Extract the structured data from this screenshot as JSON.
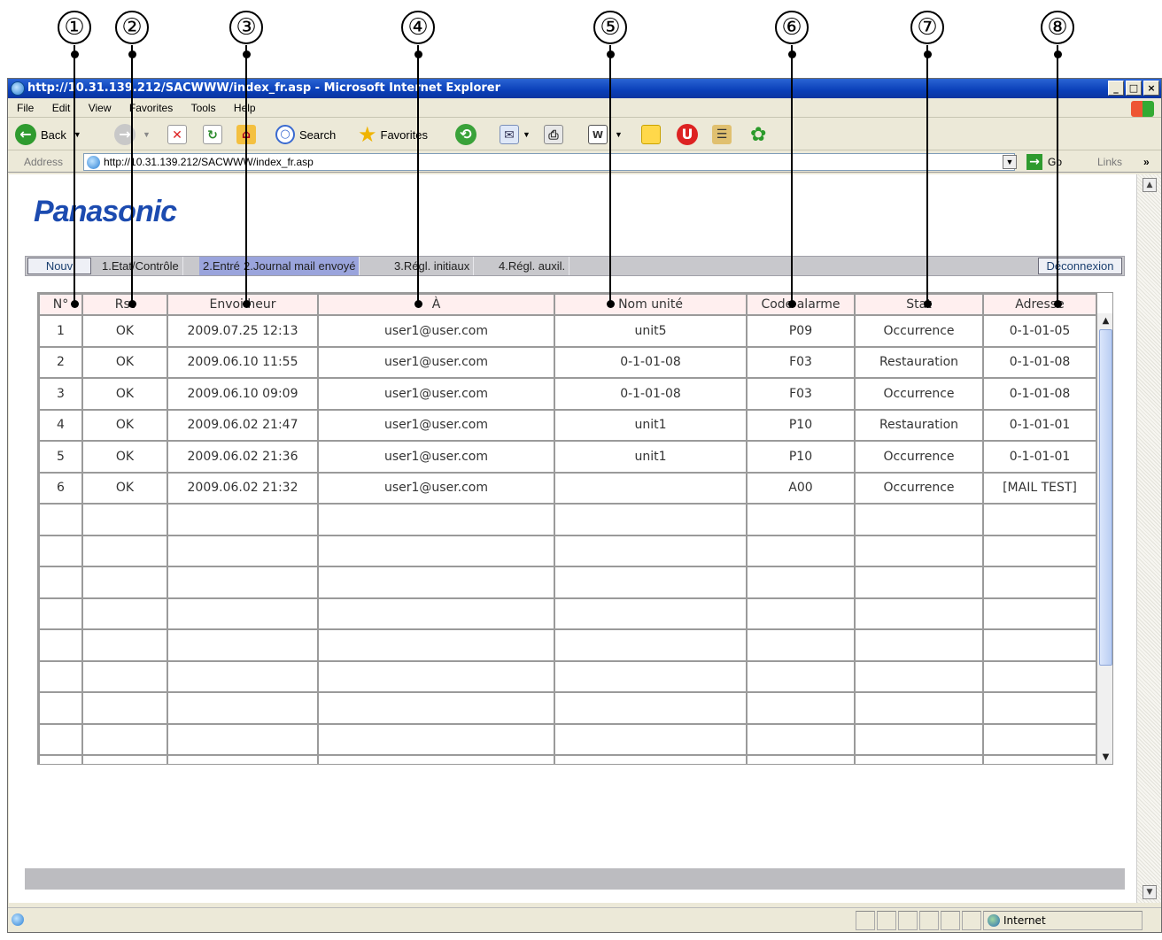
{
  "callouts": [
    "①",
    "②",
    "③",
    "④",
    "⑤",
    "⑥",
    "⑦",
    "⑧"
  ],
  "window": {
    "title": "http://10.31.139.212/SACWWW/index_fr.asp - Microsoft Internet Explorer",
    "controls": [
      "_",
      "□",
      "×"
    ]
  },
  "menu": [
    "File",
    "Edit",
    "View",
    "Favorites",
    "Tools",
    "Help"
  ],
  "toolbar": {
    "back": "Back",
    "search": "Search",
    "favorites": "Favorites"
  },
  "address": {
    "label": "Address",
    "url": "http://10.31.139.212/SACWWW/index_fr.asp",
    "go": "Go",
    "links": "Links"
  },
  "logo": "Panasonic",
  "nav": {
    "nouv": "Nouv",
    "tab1": "1.Etat/Contrôle",
    "tab2a": "2.Entré",
    "tab2b": "2.Journal mail envoyé",
    "tab3": "3.Régl. initiaux",
    "tab4": "4.Régl. auxil.",
    "logout": "Déconnexion"
  },
  "table": {
    "headers": [
      "N°",
      "Rst",
      "Envoi heur",
      "À",
      "Nom unité",
      "Code alarme",
      "Stat",
      "Adresse"
    ],
    "rows": [
      [
        "1",
        "OK",
        "2009.07.25 12:13",
        "user1@user.com",
        "unit5",
        "P09",
        "Occurrence",
        "0-1-01-05"
      ],
      [
        "2",
        "OK",
        "2009.06.10 11:55",
        "user1@user.com",
        "0-1-01-08",
        "F03",
        "Restauration",
        "0-1-01-08"
      ],
      [
        "3",
        "OK",
        "2009.06.10 09:09",
        "user1@user.com",
        "0-1-01-08",
        "F03",
        "Occurrence",
        "0-1-01-08"
      ],
      [
        "4",
        "OK",
        "2009.06.02 21:47",
        "user1@user.com",
        "unit1",
        "P10",
        "Restauration",
        "0-1-01-01"
      ],
      [
        "5",
        "OK",
        "2009.06.02 21:36",
        "user1@user.com",
        "unit1",
        "P10",
        "Occurrence",
        "0-1-01-01"
      ],
      [
        "6",
        "OK",
        "2009.06.02 21:32",
        "user1@user.com",
        "",
        "A00",
        "Occurrence",
        "[MAIL TEST]"
      ]
    ],
    "empty_rows": 9
  },
  "status": {
    "zone": "Internet"
  }
}
